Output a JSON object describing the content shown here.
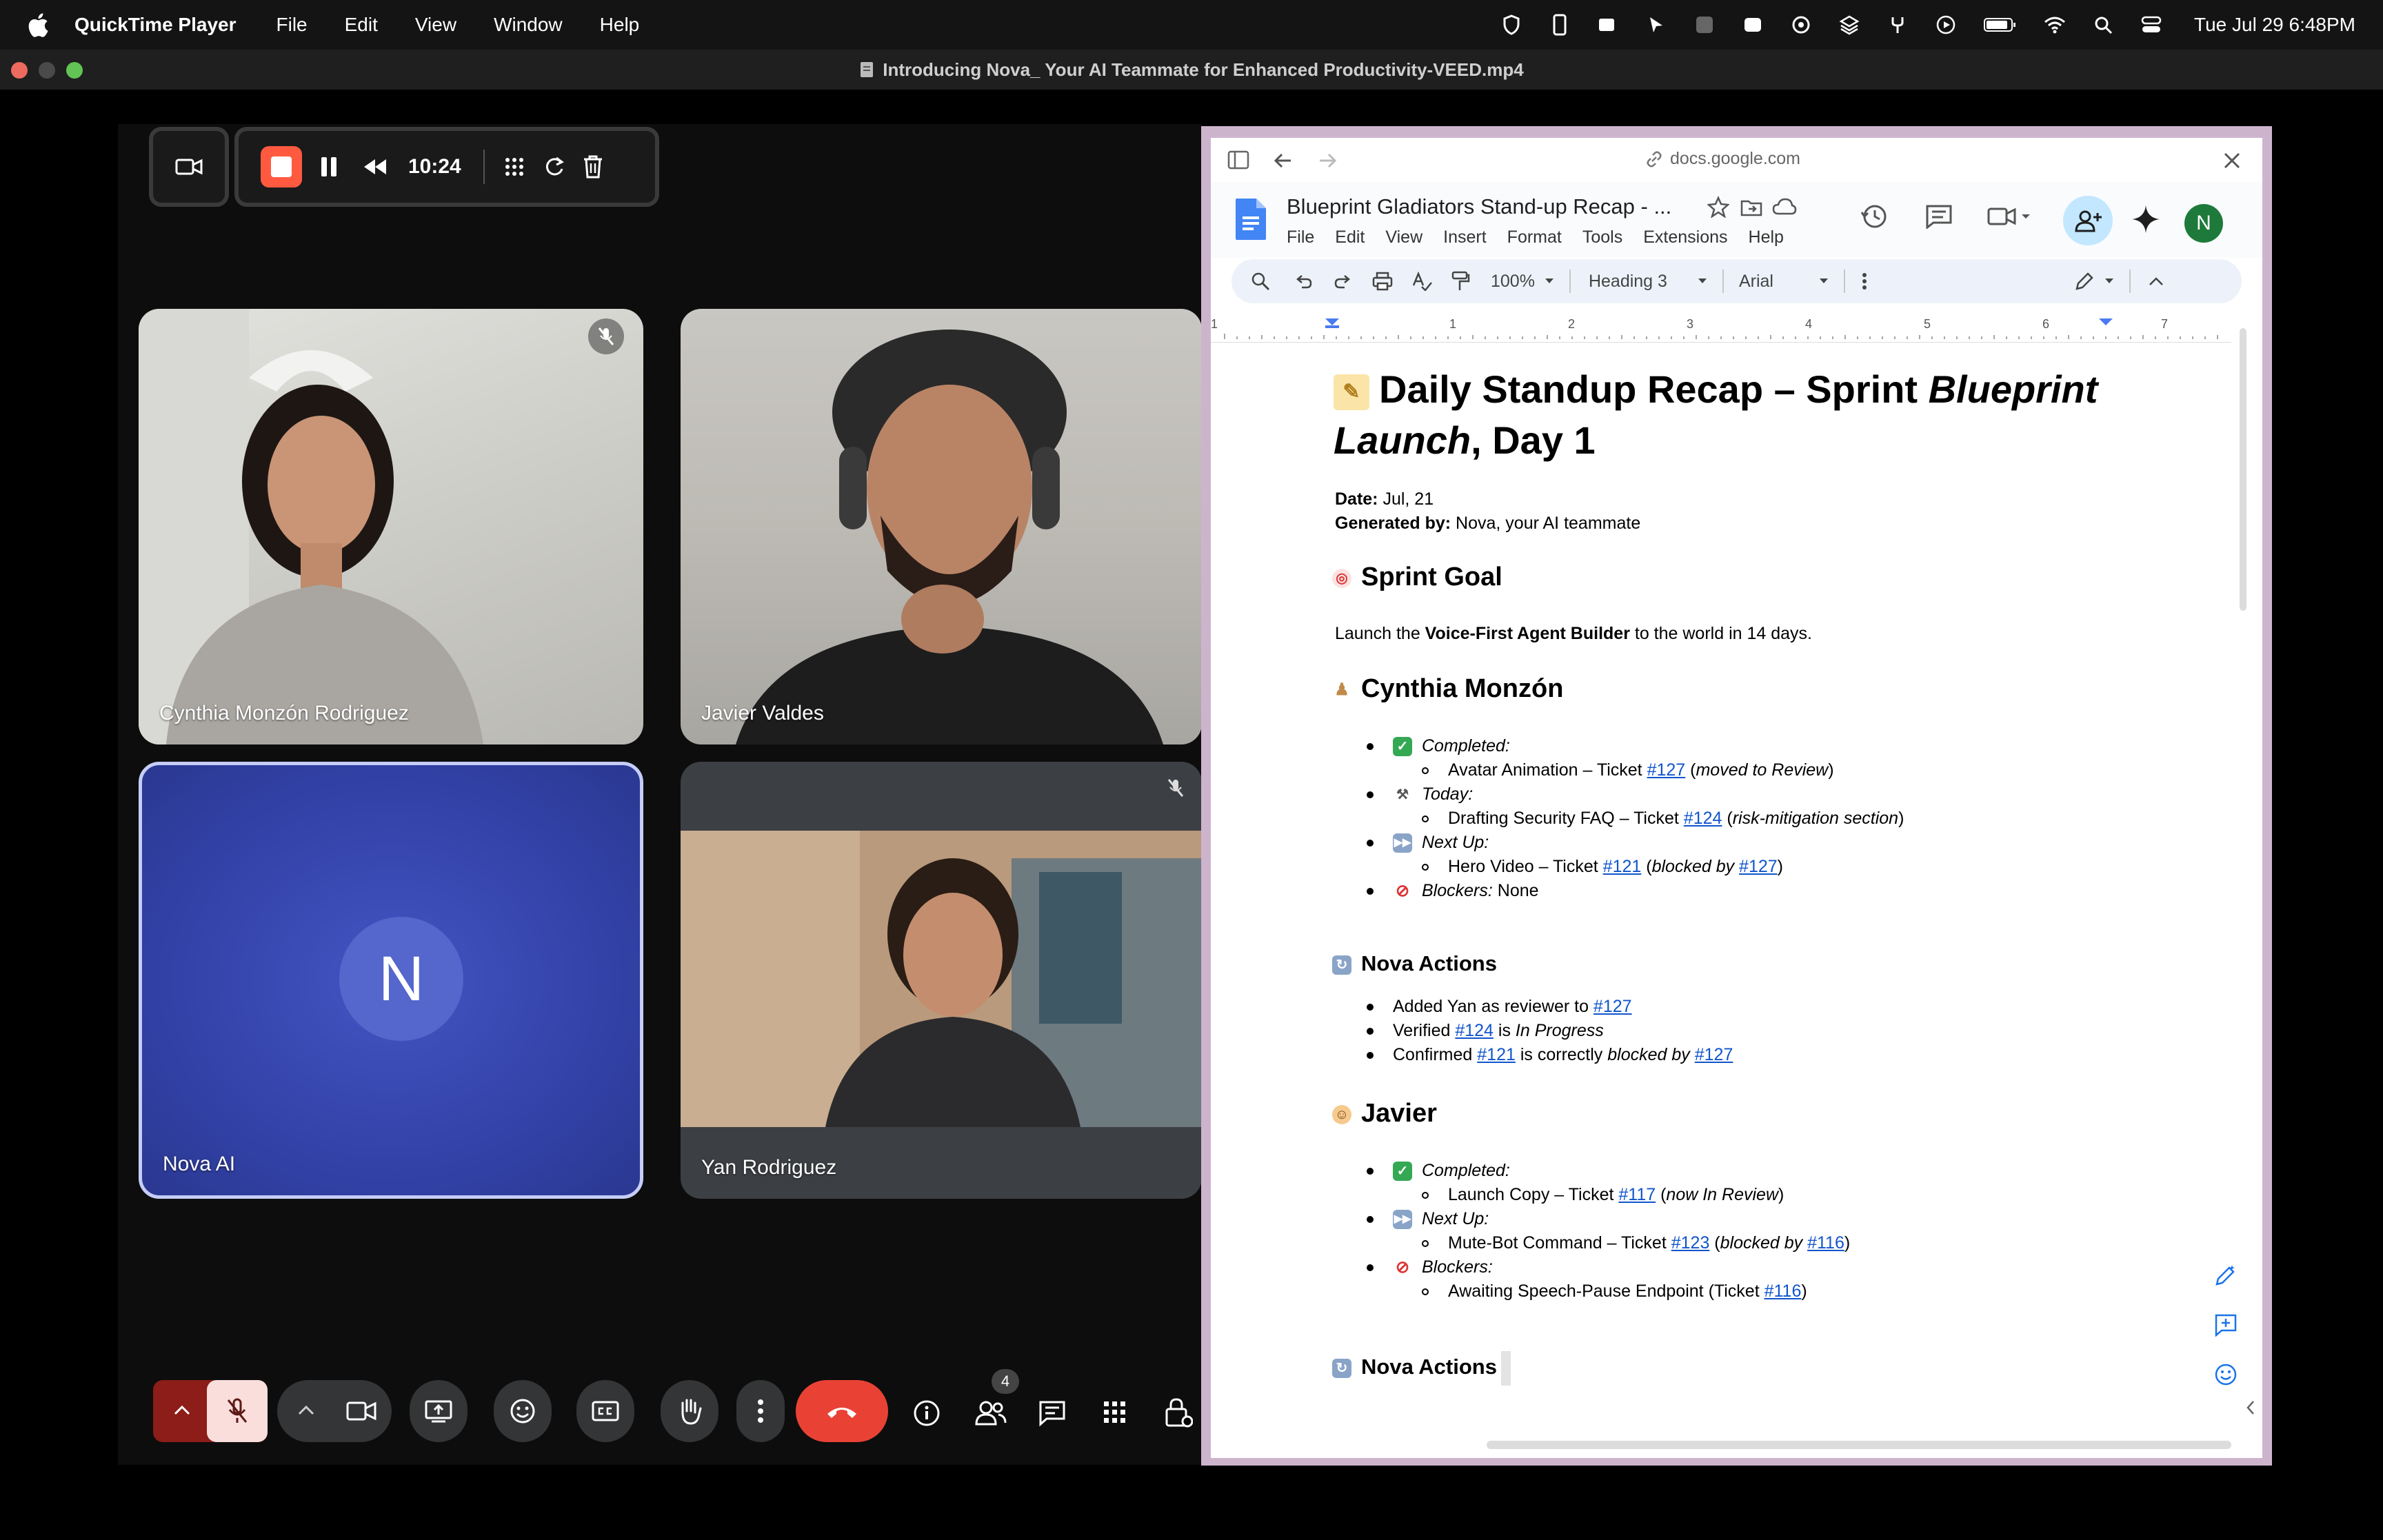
{
  "menubar": {
    "app_name": "QuickTime Player",
    "items": [
      "File",
      "Edit",
      "View",
      "Window",
      "Help"
    ],
    "clock": "Tue Jul 29  6:48PM"
  },
  "window": {
    "title": "Introducing Nova_ Your AI Teammate for Enhanced Productivity-VEED.mp4"
  },
  "recorder": {
    "time": "10:24"
  },
  "meet": {
    "participants": [
      {
        "name": "Cynthia Monzón Rodriguez",
        "muted": true
      },
      {
        "name": "Javier Valdes",
        "muted": false
      },
      {
        "name": "Nova AI",
        "initial": "N",
        "muted": false
      },
      {
        "name": "Yan Rodriguez",
        "muted": true
      }
    ],
    "people_count": "4",
    "colors": {
      "end_call": "#e94235",
      "mic_off": "#f9dedc",
      "nova_tile": "#3c4bb0"
    }
  },
  "docs": {
    "url": "docs.google.com",
    "title": "Blueprint Gladiators Stand-up Recap - ...",
    "menu": [
      "File",
      "Edit",
      "View",
      "Insert",
      "Format",
      "Tools",
      "Extensions",
      "Help"
    ],
    "avatar_initial": "N",
    "zoom": "100%",
    "style": "Heading 3",
    "font": "Arial",
    "ruler": [
      "1",
      "1",
      "2",
      "3",
      "4",
      "5",
      "6",
      "7"
    ],
    "content": {
      "h1_part1": "Daily Standup Recap – Sprint ",
      "h1_italic": "Blueprint Launch",
      "h1_part2": ", Day 1",
      "date_label": "Date:",
      "date_value": " Jul, 21",
      "gen_label": "Generated by:",
      "gen_value": " Nova, your AI teammate",
      "sprint_goal_heading": "Sprint Goal",
      "sprint_goal_pre": "Launch the ",
      "sprint_goal_bold": "Voice-First Agent Builder",
      "sprint_goal_post": " to the world in 14 days.",
      "cynthia_heading": "Cynthia Monzón",
      "completed": "Completed:",
      "today": "Today:",
      "next_up": "Next Up:",
      "blockers": "Blockers:",
      "none": " None",
      "c_item1_pre": "Avatar Animation – Ticket ",
      "t127": "#127",
      "c_item1_post": "moved to Review",
      "c_item2_pre": "Drafting Security FAQ – Ticket ",
      "t124": "#124",
      "c_item2_post": "risk-mitigation section",
      "c_item3_pre": "Hero Video – Ticket ",
      "t121": "#121",
      "blocked_by": "blocked by ",
      "nova_actions": "Nova Actions",
      "na1_pre": "Added Yan as reviewer to ",
      "na2_pre": "Verified ",
      "na2_mid": " is ",
      "na2_post": "In Progress",
      "na3_pre": "Confirmed ",
      "na3_mid": " is correctly ",
      "na3_italic": "blocked by",
      "javier_heading": "Javier",
      "j_item1_pre": "Launch Copy – Ticket ",
      "t117": "#117",
      "j_item1_post": "now In Review",
      "j_item2_pre": "Mute-Bot Command – Ticket ",
      "t123": "#123",
      "t116": "#116",
      "j_item3_pre": "Awaiting Speech-Pause Endpoint (Ticket ",
      "close_paren": ")"
    }
  }
}
